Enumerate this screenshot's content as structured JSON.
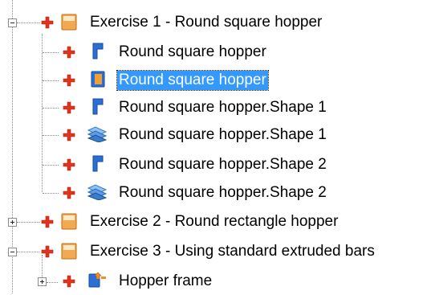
{
  "tree": {
    "items": [
      {
        "label": "Exercise 1 - Round square hopper",
        "expanded": true,
        "icon": "exercise-icon"
      },
      {
        "label": "Round square hopper",
        "icon": "part-icon"
      },
      {
        "label": "Round square hopper",
        "icon": "part-open-icon",
        "selected": true
      },
      {
        "label": "Round square hopper.Shape 1",
        "icon": "part-icon"
      },
      {
        "label": "Round square hopper.Shape 1",
        "icon": "sheet-icon"
      },
      {
        "label": "Round square hopper.Shape 2",
        "icon": "part-icon"
      },
      {
        "label": "Round square hopper.Shape 2",
        "icon": "sheet-icon"
      },
      {
        "label": "Exercise 2 - Round rectangle hopper",
        "expanded": false,
        "icon": "exercise-icon"
      },
      {
        "label": "Exercise 3 - Using standard extruded bars",
        "expanded": true,
        "icon": "exercise-icon"
      },
      {
        "label": "Hopper frame",
        "expanded": false,
        "icon": "assembly-icon"
      }
    ],
    "colors": {
      "selection": "#3399ff",
      "plus": "#e0341e",
      "part_blue": "#2a6fd6",
      "exercise_orange": "#f08c2a"
    }
  }
}
